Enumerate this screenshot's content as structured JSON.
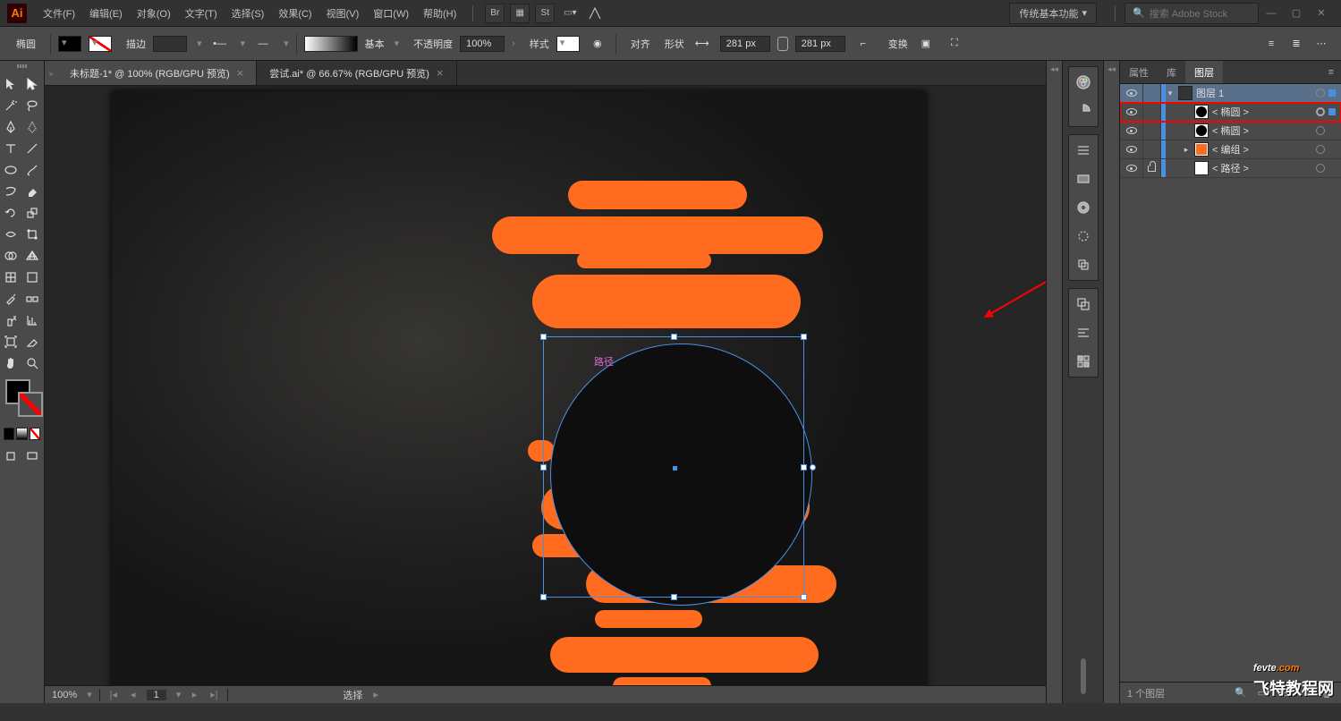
{
  "menubar": {
    "items": [
      "文件(F)",
      "编辑(E)",
      "对象(O)",
      "文字(T)",
      "选择(S)",
      "效果(C)",
      "视图(V)",
      "窗口(W)",
      "帮助(H)"
    ],
    "bridge": "Br",
    "stock": "St",
    "workspace": "传统基本功能",
    "search_placeholder": "搜索 Adobe Stock"
  },
  "optionsbar": {
    "shape": "椭圆",
    "stroke_label": "描边",
    "stroke_pt": "",
    "style_preset": "基本",
    "opacity_label": "不透明度",
    "opacity_value": "100%",
    "style_label": "样式",
    "align_label": "对齐",
    "shape_label2": "形状",
    "width_value": "281 px",
    "height_value": "281 px",
    "transform_label": "变换"
  },
  "tabs": [
    {
      "title": "未标题-1* @ 100% (RGB/GPU 预览)",
      "active": true
    },
    {
      "title": "尝试.ai* @ 66.67% (RGB/GPU 预览)",
      "active": false
    }
  ],
  "canvas": {
    "path_hint": "路径"
  },
  "statusbar": {
    "zoom": "100%",
    "page": "1",
    "mode": "选择"
  },
  "layers_panel": {
    "tabs": [
      "属性",
      "库",
      "图层"
    ],
    "active_tab": 2,
    "rows": [
      {
        "vis": true,
        "lock": false,
        "depth": 0,
        "expander": "down",
        "thumb": "layer",
        "name": "图层 1",
        "target": "o",
        "sel": true,
        "hl": false,
        "rowsel": true
      },
      {
        "vis": true,
        "lock": false,
        "depth": 1,
        "expander": "",
        "thumb": "circle",
        "name": "< 椭圆 >",
        "target": "dbl",
        "sel": true,
        "hl": true,
        "rowsel": false
      },
      {
        "vis": true,
        "lock": false,
        "depth": 1,
        "expander": "",
        "thumb": "circle",
        "name": "< 椭圆 >",
        "target": "o",
        "sel": false,
        "hl": false,
        "rowsel": false
      },
      {
        "vis": true,
        "lock": false,
        "depth": 1,
        "expander": "right",
        "thumb": "orange",
        "name": "< 编组 >",
        "target": "o",
        "sel": false,
        "hl": false,
        "rowsel": false
      },
      {
        "vis": true,
        "lock": true,
        "depth": 1,
        "expander": "",
        "thumb": "white",
        "name": "< 路径 >",
        "target": "o",
        "sel": false,
        "hl": false,
        "rowsel": false
      }
    ],
    "footer": "1 个图层"
  },
  "watermark": {
    "line1a": "fevte",
    "line1b": ".com",
    "line2": "飞特教程网"
  }
}
